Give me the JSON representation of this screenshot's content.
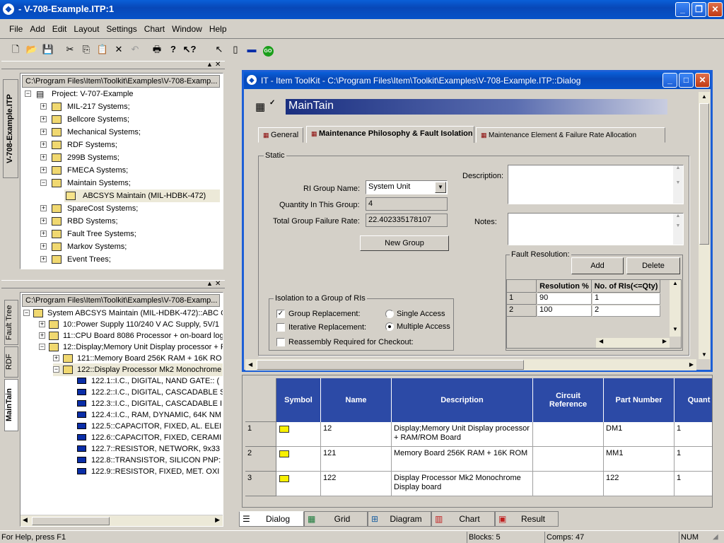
{
  "window": {
    "title": "- V-708-Example.ITP:1"
  },
  "menu": [
    "File",
    "Add",
    "Edit",
    "Layout",
    "Settings",
    "Chart",
    "Window",
    "Help"
  ],
  "top_tree": {
    "path": "C:\\Program Files\\Item\\Toolkit\\Examples\\V-708-Examp...",
    "project": "Project:  V-707-Example",
    "items": [
      "MIL-217 Systems;",
      "Bellcore Systems;",
      "Mechanical Systems;",
      "RDF Systems;",
      "299B Systems;",
      "FMECA Systems;",
      "Maintain Systems;",
      "ABCSYS Maintain (MIL-HDBK-472)",
      "SpareCost Systems;",
      "RBD Systems;",
      "Fault Tree Systems;",
      "Markov Systems;",
      "Event Trees;"
    ],
    "side_tab": "V-708-Example.ITP"
  },
  "bottom_tree": {
    "path": "C:\\Program Files\\Item\\Toolkit\\Examples\\V-708-Examp...",
    "items": [
      "System ABCSYS Maintain (MIL-HDBK-472)::ABC C",
      "10::Power Supply 110/240 V AC Supply, 5V/1",
      "11::CPU Board 8086 Processor + on-board log",
      "12::Display;Memory Unit Display processor + R",
      "121::Memory Board 256K RAM + 16K RO",
      "122::Display Processor Mk2 Monochrome",
      "122.1::I.C., DIGITAL, NAND GATE:: (",
      "122.2::I.C., DIGITAL, CASCADABLE S",
      "122.3::I.C., DIGITAL, CASCADABLE I",
      "122.4::I.C., RAM, DYNAMIC, 64K NM",
      "122.5::CAPACITOR, FIXED, AL. ELEI",
      "122.6::CAPACITOR, FIXED, CERAMI",
      "122.7::RESISTOR, NETWORK, 9x33",
      "122.8::TRANSISTOR, SILICON PNP:",
      "122.9::RESISTOR, FIXED, MET. OXI"
    ],
    "side_tabs": [
      "Fault Tree",
      "RDF",
      "MainTain"
    ]
  },
  "dialog": {
    "title": "IT - Item ToolKit - C:\\Program Files\\Item\\Toolkit\\Examples\\V-708-Example.ITP::Dialog",
    "header": "MainTain",
    "tabs": [
      "General",
      "Maintenance Philosophy & Fault Isolation",
      "Maintenance Element & Failure Rate Allocation"
    ],
    "static_label": "Static",
    "ri_group_label": "RI Group Name:",
    "ri_group_value": "System Unit",
    "qty_label": "Quantity In This Group:",
    "qty_value": "4",
    "tgfr_label": "Total Group Failure Rate:",
    "tgfr_value": "22.402335178107",
    "new_group": "New Group",
    "description_label": "Description:",
    "notes_label": "Notes:",
    "fault_resolution": "Fault Resolution:",
    "add": "Add",
    "delete": "Delete",
    "fr_cols": [
      "Resolution %",
      "No. of RIs(<=Qty)"
    ],
    "fr_rows": [
      [
        "1",
        "90",
        "1"
      ],
      [
        "2",
        "100",
        "2"
      ]
    ],
    "isolation_label": "Isolation to a Group of RIs",
    "group_replacement": "Group Replacement:",
    "iterative_replacement": "Iterative Replacement:",
    "reassembly": "Reassembly Required for Checkout:",
    "single_access": "Single Access",
    "multiple_access": "Multiple Access"
  },
  "grid": {
    "cols": [
      "Symbol",
      "Name",
      "Description",
      "Circuit Reference",
      "Part Number",
      "Quant"
    ],
    "rows": [
      {
        "n": "1",
        "name": "12",
        "desc": "Display;Memory Unit Display processor + RAM/ROM Board",
        "part": "DM1",
        "qty": "1"
      },
      {
        "n": "2",
        "name": "121",
        "desc": "Memory Board 256K RAM + 16K ROM",
        "part": "MM1",
        "qty": "1"
      },
      {
        "n": "3",
        "name": "122",
        "desc": "Display Processor Mk2 Monochrome Display board",
        "part": "122",
        "qty": "1"
      }
    ]
  },
  "bottom_tabs": [
    "Dialog",
    "Grid",
    "Diagram",
    "Chart",
    "Result"
  ],
  "status": {
    "help": "For Help, press F1",
    "blocks": "Blocks: 5",
    "comps": "Comps: 47",
    "num": "NUM"
  }
}
